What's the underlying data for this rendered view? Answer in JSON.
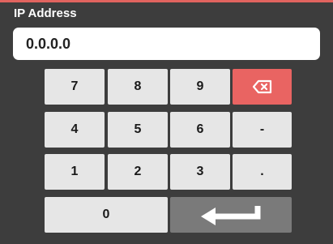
{
  "dialog": {
    "title": "IP Address",
    "value": "0.0.0.0"
  },
  "keypad": {
    "keys": [
      "7",
      "8",
      "9",
      "4",
      "5",
      "6",
      "-",
      "1",
      "2",
      "3",
      ".",
      "0"
    ],
    "backspace_icon": "backspace-icon",
    "enter_icon": "enter-return-icon"
  },
  "colors": {
    "background": "#3d3d3d",
    "accent": "#e1645f",
    "key": "#e6e6e6",
    "backspace_key": "#e96462",
    "enter_key": "#7a7a7a"
  }
}
